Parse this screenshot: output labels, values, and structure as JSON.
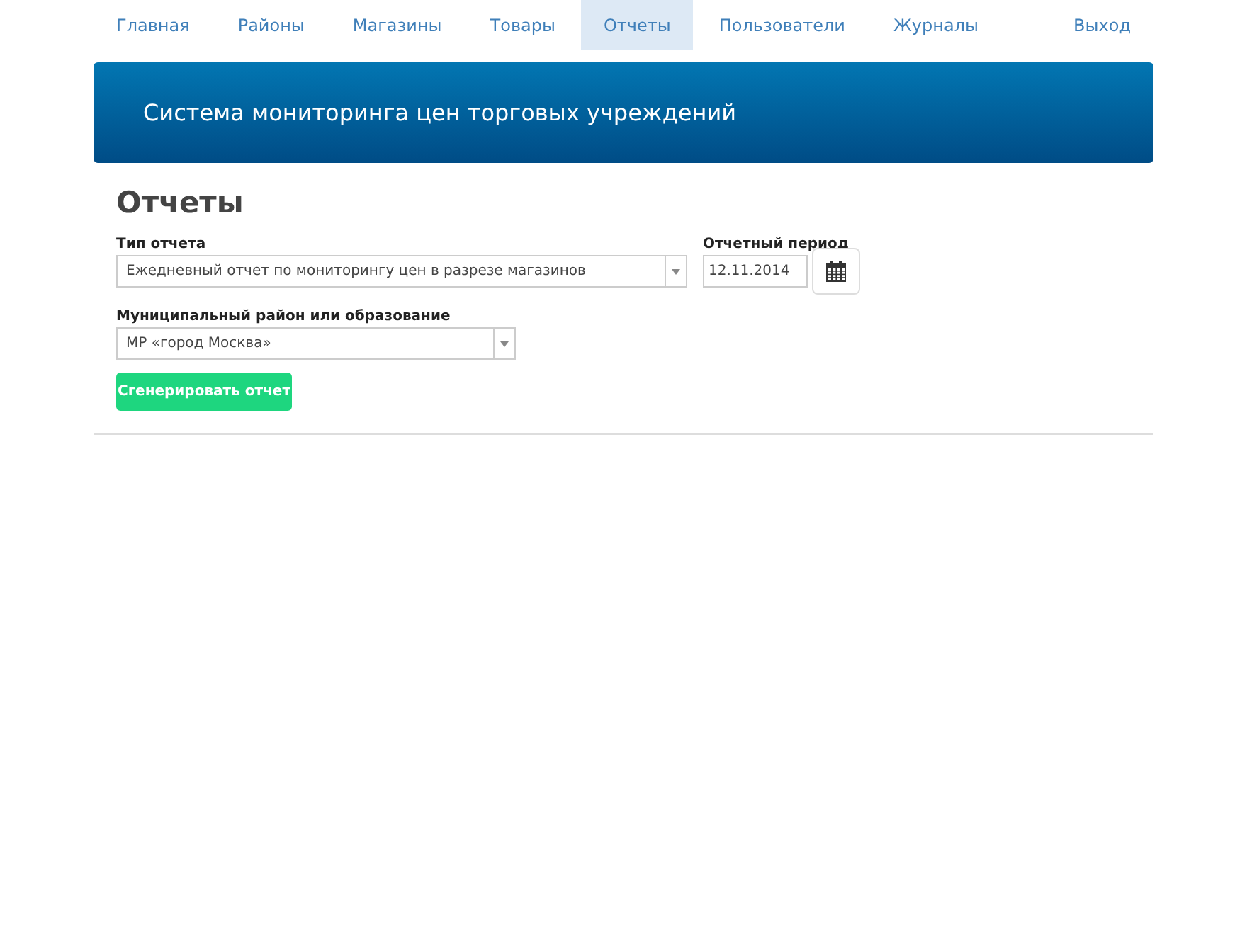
{
  "nav": {
    "items": [
      {
        "label": "Главная",
        "selected": false
      },
      {
        "label": "Районы",
        "selected": false
      },
      {
        "label": "Магазины",
        "selected": false
      },
      {
        "label": "Товары",
        "selected": false
      },
      {
        "label": "Отчеты",
        "selected": true
      },
      {
        "label": "Пользователи",
        "selected": false
      },
      {
        "label": "Журналы",
        "selected": false
      }
    ],
    "logout": "Выход"
  },
  "banner": {
    "title": "Система мониторинга цен торговых учреждений"
  },
  "page": {
    "heading": "Отчеты",
    "report_type": {
      "label": "Тип отчета",
      "value": "Ежедневный отчет по мониторингу цен в разрезе магазинов"
    },
    "period": {
      "label": "Отчетный период",
      "value": "12.11.2014"
    },
    "district": {
      "label": "Муниципальный район или образование",
      "value": "МР «город Москва»"
    },
    "button": "Сгенерировать отчет"
  }
}
